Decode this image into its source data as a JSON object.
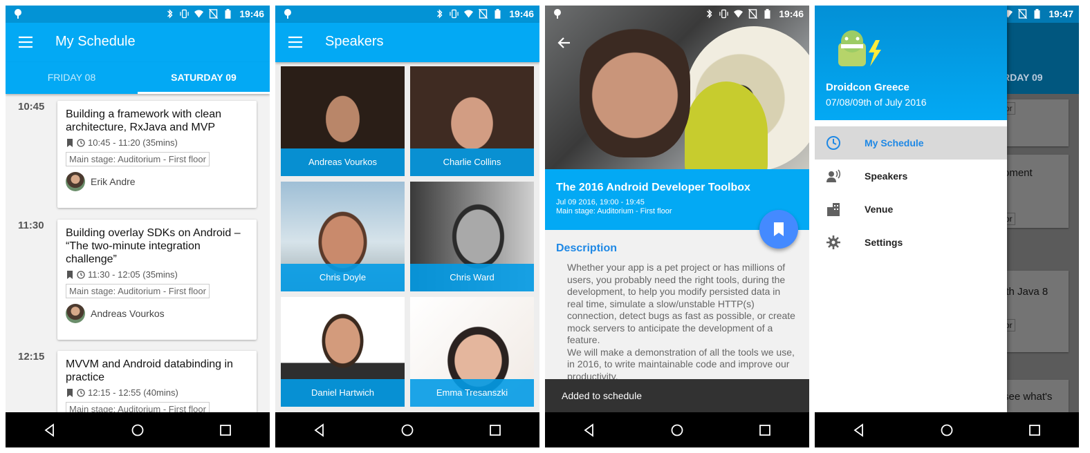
{
  "status": {
    "time1": "19:46",
    "time2": "19:46",
    "time3": "19:46",
    "time4": "19:47"
  },
  "schedule": {
    "title": "My Schedule",
    "tabs": [
      {
        "label": "FRIDAY 08"
      },
      {
        "label": "SATURDAY 09"
      }
    ],
    "slots": [
      {
        "time": "10:45",
        "title": "Building a framework with clean architecture, RxJava and MVP",
        "when": "10:45 - 11:20 (35mins)",
        "room": "Main stage: Auditorium - First floor",
        "speaker": "Erik Andre"
      },
      {
        "time": "11:30",
        "title": "Building overlay SDKs on Android – “The two-minute integration challenge”",
        "when": "11:30 - 12:05 (35mins)",
        "room": "Main stage: Auditorium - First floor",
        "speaker": "Andreas Vourkos"
      },
      {
        "time": "12:15",
        "title": "MVVM and Android databinding in practice",
        "when": "12:15 - 12:55 (40mins)",
        "room": "Main stage: Auditorium - First floor",
        "speaker": ""
      }
    ]
  },
  "speakers": {
    "title": "Speakers",
    "items": [
      {
        "name": "Andreas Vourkos"
      },
      {
        "name": "Charlie Collins"
      },
      {
        "name": "Chris Doyle"
      },
      {
        "name": "Chris Ward"
      },
      {
        "name": "Daniel Hartwich"
      },
      {
        "name": "Emma Tresanszki"
      }
    ]
  },
  "detail": {
    "title": "The 2016 Android Developer Toolbox",
    "when": "Jul 09 2016, 19:00 - 19:45",
    "room": "Main stage: Auditorium - First floor",
    "desc_heading": "Description",
    "desc_body": "Whether your app is a pet project or has millions of users, you probably need the right tools, during the development, to help you modify persisted data in real time, simulate a slow/unstable HTTP(s) connection, detect bugs as fast as possible, or create mock servers to anticipate the development of a feature.\nWe will make a demonstration of all the tools we use, in 2016, to write maintainable code and improve our productivity.",
    "snackbar": "Added to schedule"
  },
  "drawer": {
    "name": "Droidcon Greece",
    "dates": "07/08/09th of July 2016",
    "items": [
      {
        "label": "My Schedule"
      },
      {
        "label": "Speakers"
      },
      {
        "label": "Venue"
      },
      {
        "label": "Settings"
      }
    ],
    "behind_tab": "RDAY 09",
    "behind_texts": [
      "oment",
      "ith Java 8",
      "see what's"
    ],
    "behind_chips": [
      "or",
      "or",
      "or"
    ]
  },
  "colors": {
    "primary": "#03A9F4",
    "accent": "#448AFF"
  }
}
